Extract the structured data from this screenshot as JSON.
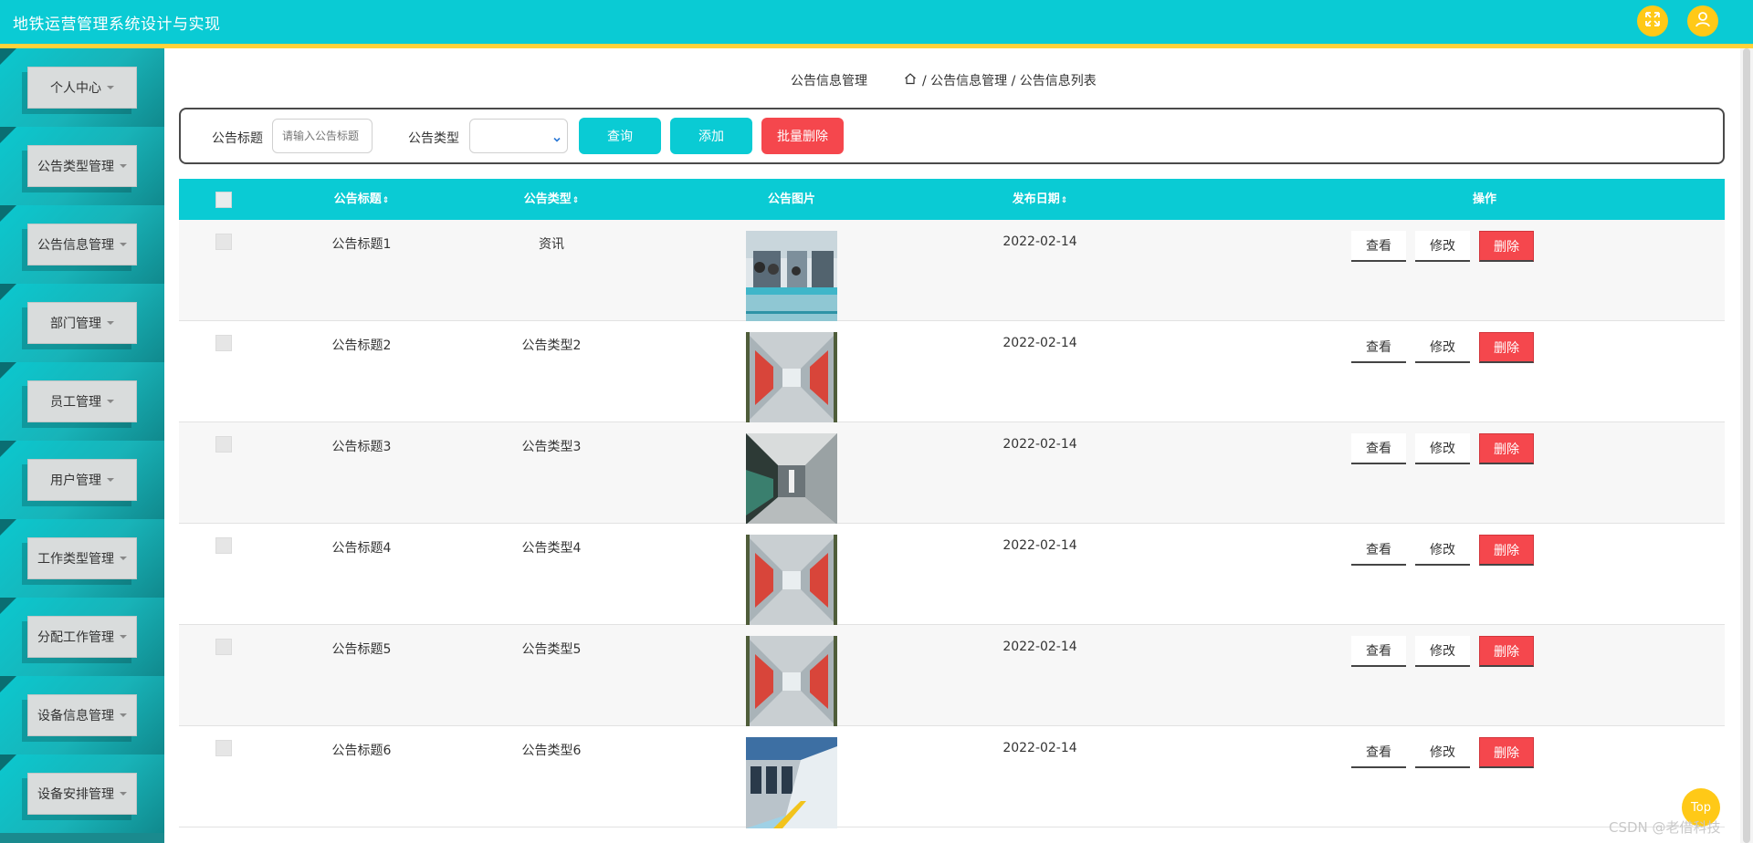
{
  "header": {
    "title": "地铁运营管理系统设计与实现",
    "colors": {
      "bar": "#0acbd4",
      "accent": "#ffd23a",
      "roundButtons": "#ffc917"
    },
    "fullscreen_icon": "fullscreen-icon",
    "user_icon": "user-icon"
  },
  "sidebar": {
    "items": [
      {
        "label": "个人中心"
      },
      {
        "label": "公告类型管理"
      },
      {
        "label": "公告信息管理"
      },
      {
        "label": "部门管理"
      },
      {
        "label": "员工管理"
      },
      {
        "label": "用户管理"
      },
      {
        "label": "工作类型管理"
      },
      {
        "label": "分配工作管理"
      },
      {
        "label": "设备信息管理"
      },
      {
        "label": "设备安排管理"
      }
    ]
  },
  "breadcrumb": {
    "title": "公告信息管理",
    "path": "/ 公告信息管理 / 公告信息列表"
  },
  "search": {
    "title_label": "公告标题",
    "title_placeholder": "请输入公告标题",
    "type_label": "公告类型",
    "type_value": "",
    "query_label": "查询",
    "add_label": "添加",
    "batch_delete_label": "批量删除"
  },
  "table": {
    "headers": {
      "title": "公告标题",
      "type": "公告类型",
      "image": "公告图片",
      "date": "发布日期",
      "actions": "操作"
    },
    "sort_glyph": "⇕",
    "rows": [
      {
        "title": "公告标题1",
        "type": "资讯",
        "date": "2022-02-14",
        "image": "platform"
      },
      {
        "title": "公告标题2",
        "type": "公告类型2",
        "date": "2022-02-14",
        "image": "carriage"
      },
      {
        "title": "公告标题3",
        "type": "公告类型3",
        "date": "2022-02-14",
        "image": "station"
      },
      {
        "title": "公告标题4",
        "type": "公告类型4",
        "date": "2022-02-14",
        "image": "carriage"
      },
      {
        "title": "公告标题5",
        "type": "公告类型5",
        "date": "2022-02-14",
        "image": "carriage"
      },
      {
        "title": "公告标题6",
        "type": "公告类型6",
        "date": "2022-02-14",
        "image": "train"
      }
    ],
    "actions": {
      "view": "查看",
      "edit": "修改",
      "delete": "删除"
    }
  },
  "back_to_top": "Top",
  "watermark": "CSDN @老借科技"
}
